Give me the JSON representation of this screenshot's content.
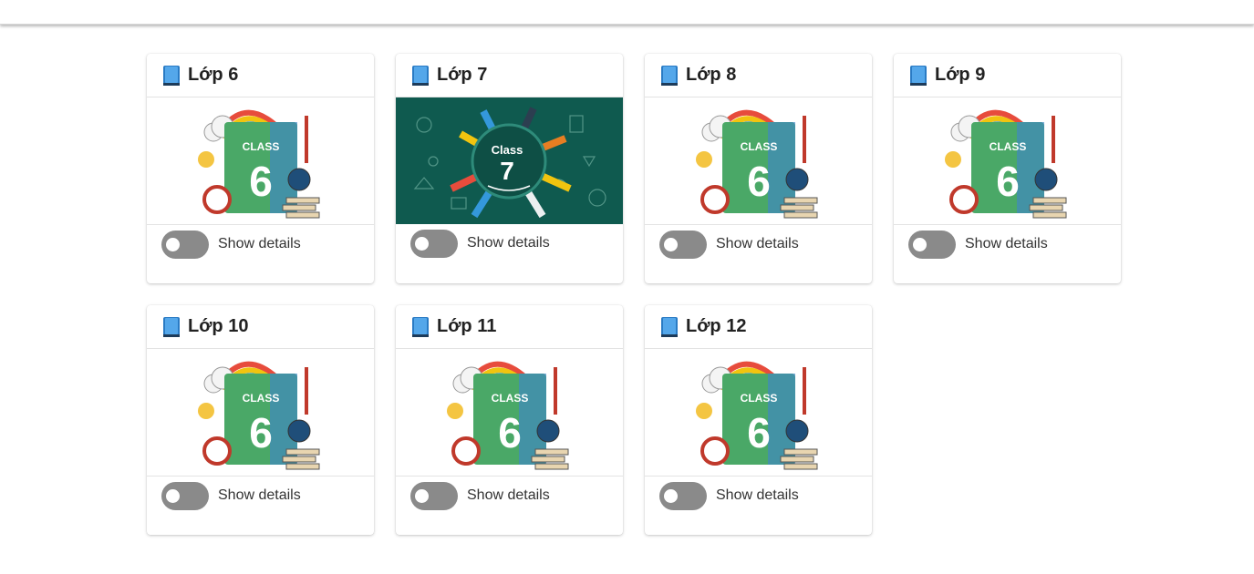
{
  "cards": [
    {
      "title": "Lớp 6",
      "badge": "CLASS",
      "number": "6",
      "style": "book"
    },
    {
      "title": "Lớp 7",
      "badge": "Class",
      "number": "7",
      "style": "chalkboard"
    },
    {
      "title": "Lớp 8",
      "badge": "CLASS",
      "number": "6",
      "style": "book"
    },
    {
      "title": "Lớp 9",
      "badge": "CLASS",
      "number": "6",
      "style": "book"
    },
    {
      "title": "Lớp 10",
      "badge": "CLASS",
      "number": "6",
      "style": "book"
    },
    {
      "title": "Lớp 11",
      "badge": "CLASS",
      "number": "6",
      "style": "book"
    },
    {
      "title": "Lớp 12",
      "badge": "CLASS",
      "number": "6",
      "style": "book"
    }
  ],
  "toggle_label": "Show details",
  "toggle_state": "off",
  "icons": {
    "header": "book-icon"
  },
  "colors": {
    "toggle": "#8a8a8a",
    "book_green": "#4aa867",
    "chalkboard": "#0f5a4f"
  }
}
